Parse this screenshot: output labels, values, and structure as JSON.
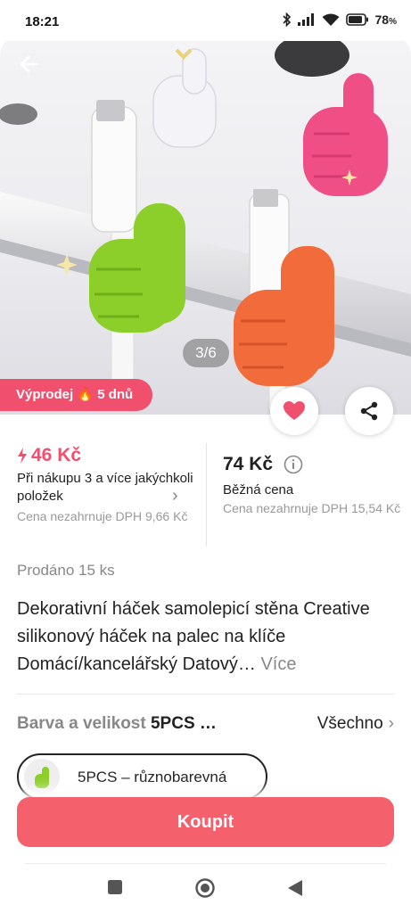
{
  "status_bar": {
    "time": "18:21",
    "battery": "78"
  },
  "gallery": {
    "counter": "3/6"
  },
  "promo": {
    "label": "Výprodej",
    "emoji": "🔥",
    "duration": "5 dnů"
  },
  "price": {
    "bulk_price": "46 Kč",
    "bulk_condition": "Při nákupu 3 a více jakýchkoli položek",
    "bulk_note": "Cena nezahrnuje DPH 9,66 Kč",
    "regular_price": "74 Kč",
    "regular_label": "Běžná cena",
    "regular_note": "Cena nezahrnuje DPH 15,54 Kč"
  },
  "sold": "Prodáno 15 ks",
  "product": {
    "title": "Dekorativní háček samolepicí stěna Creative silikonový háček na palec na klíče Domácí/kancelářský Datový…",
    "more_label": "Více"
  },
  "variant": {
    "label": "Barva a velikost",
    "selected": "5PCS …",
    "all_label": "Všechno",
    "chip_label": "5PCS – různobarevná"
  },
  "buy_label": "Koupit",
  "colors": {
    "accent": "#f0506e",
    "buy": "#f4606c",
    "green": "#8ccf2a",
    "orange": "#f26b3a",
    "pink": "#f04f86"
  }
}
